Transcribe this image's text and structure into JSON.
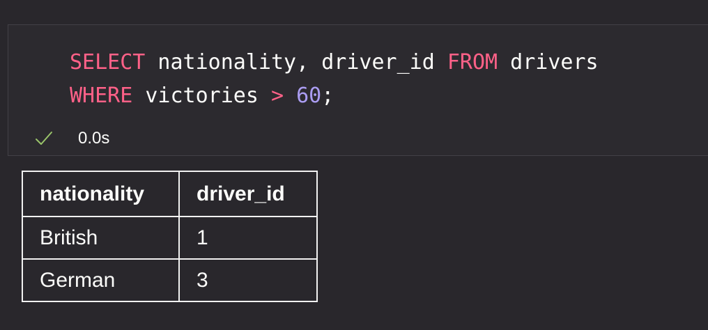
{
  "cell": {
    "code_lines": [
      [
        {
          "type": "kw",
          "text": "SELECT"
        },
        {
          "type": "plain",
          "text": " nationality, driver_id "
        },
        {
          "type": "kw",
          "text": "FROM"
        },
        {
          "type": "plain",
          "text": " drivers"
        }
      ],
      [
        {
          "type": "kw",
          "text": "WHERE"
        },
        {
          "type": "plain",
          "text": " victories "
        },
        {
          "type": "kw",
          "text": ">"
        },
        {
          "type": "plain",
          "text": " "
        },
        {
          "type": "num",
          "text": "60"
        },
        {
          "type": "plain",
          "text": ";"
        }
      ]
    ],
    "status": {
      "icon": "check-icon",
      "time": "0.0s",
      "color": "#9ac46a"
    }
  },
  "result_table": {
    "headers": [
      "nationality",
      "driver_id"
    ],
    "rows": [
      [
        "British",
        "1"
      ],
      [
        "German",
        "3"
      ]
    ]
  },
  "colors": {
    "background": "#29272c",
    "keyword": "#ff6188",
    "number": "#ab9df2",
    "text": "#fcfcfa"
  }
}
